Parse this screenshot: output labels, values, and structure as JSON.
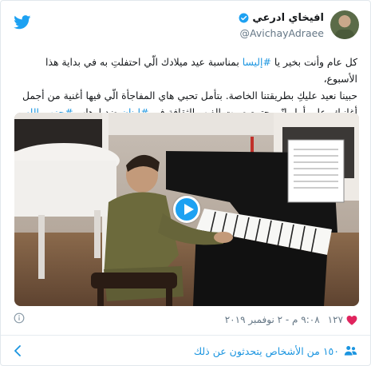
{
  "header": {
    "display_name": "افيخاي ادرعي",
    "handle": "@AvichayAdraee"
  },
  "tweet": {
    "line1_before": "كل عام وأنت بخير يا ",
    "line1_link": "#إليسا",
    "line1_after": " بمناسبة عيد ميلادك الّي احتفلتِ به في بداية هذا الأسبوع،",
    "line2": "حبينا نعيد عليكِ بطريقتنا الخاصة. بتأمل تحبي هاي المفاجأة الّي فيها أغنية من أجمل",
    "line3_part1": "أغانيكِ. على أمل إنّو يجتمع صوت الفن والثقافة في ",
    "line3_link1": "#لبنان",
    "line3_part2": " ضد إرهاب ",
    "line3_link2": "#حزب_الله",
    "line3_end": "."
  },
  "meta": {
    "likes": "١٢٧",
    "timestamp": "٩:٠٨ م - ٢ نوفمبر ٢٠١٩"
  },
  "footer": {
    "people_talking": "١٥٠ من الأشخاص يتحدثون عن ذلك"
  },
  "colors": {
    "brand": "#1da1f2",
    "link": "#1b95e0",
    "muted": "#657786",
    "like": "#e0245e"
  },
  "icons": [
    "twitter-bird-icon",
    "verified-icon",
    "play-icon",
    "heart-icon",
    "info-icon",
    "people-icon",
    "chevron-down-icon"
  ]
}
